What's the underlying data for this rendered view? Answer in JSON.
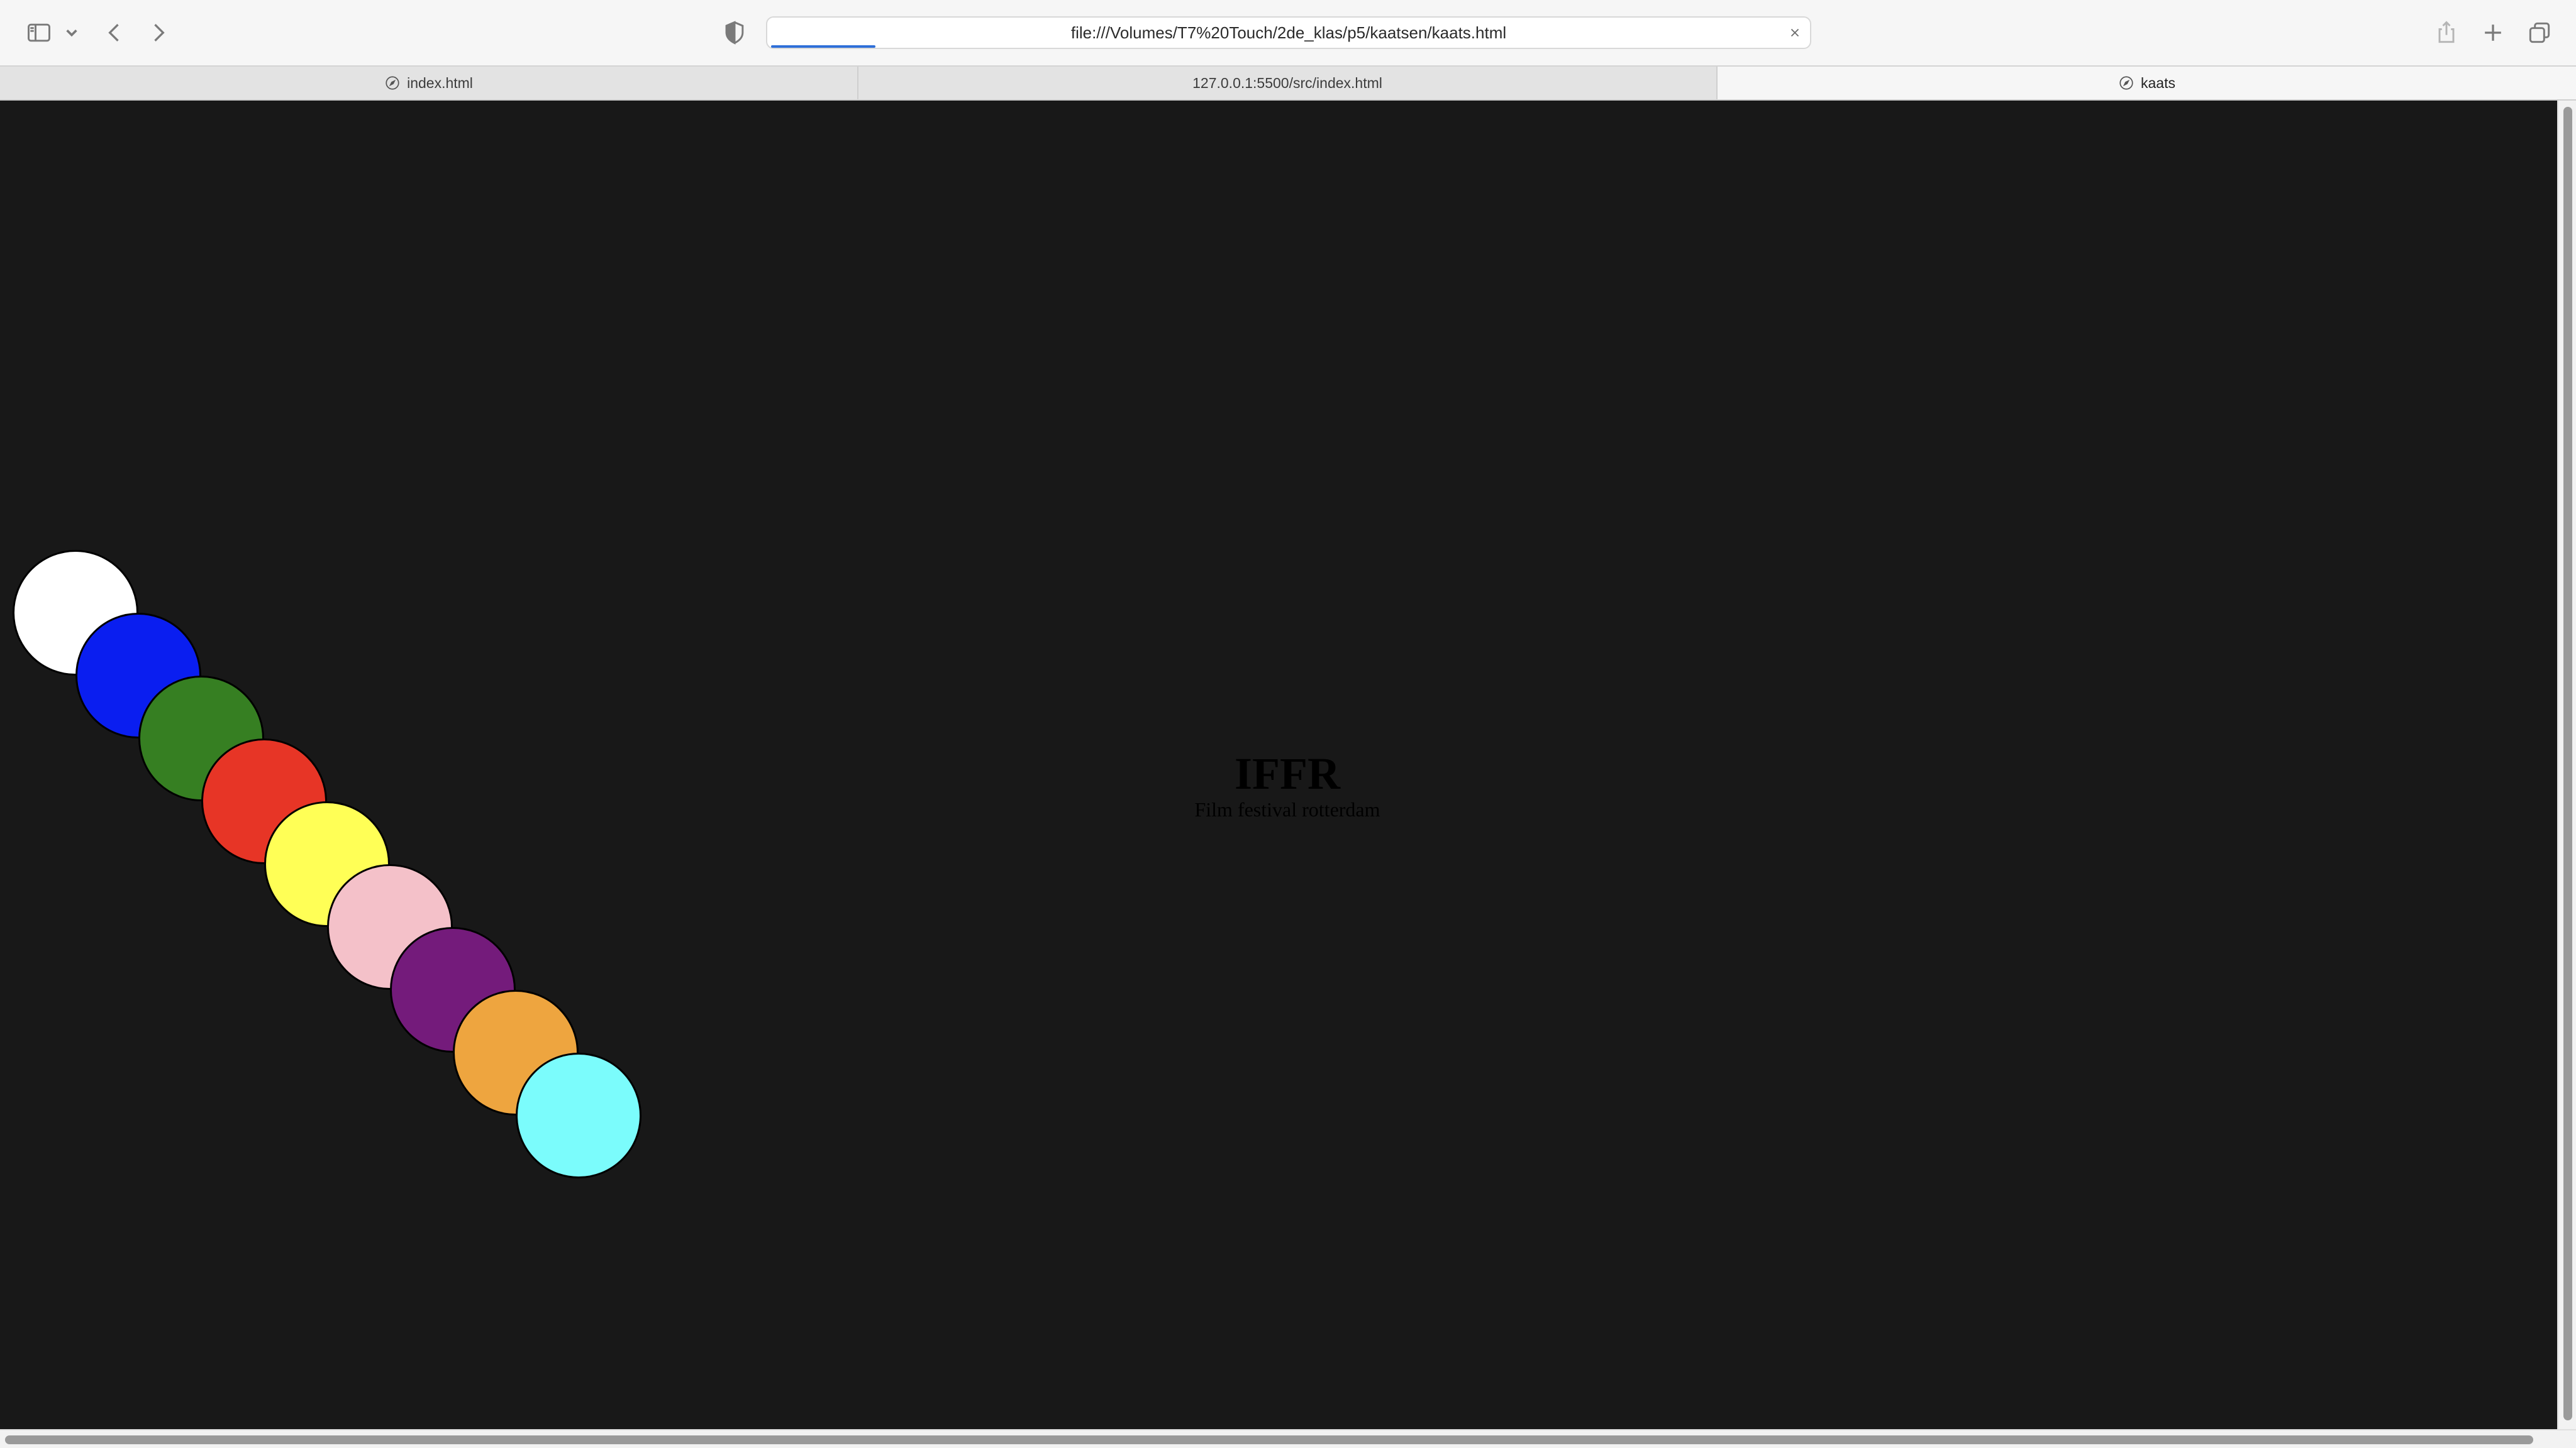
{
  "toolbar": {
    "url": "file:///Volumes/T7%20Touch/2de_klas/p5/kaatsen/kaats.html",
    "icons": [
      "sidebar-icon",
      "chevron-down-icon",
      "back-icon",
      "forward-icon",
      "shield-icon",
      "close-icon",
      "share-icon",
      "plus-icon",
      "tabs-overview-icon"
    ]
  },
  "tabs": [
    {
      "label": "index.html",
      "icon": "compass-icon"
    },
    {
      "label": "127.0.0.1:5500/src/index.html"
    },
    {
      "label": "kaats",
      "icon": "compass-icon",
      "active": true
    }
  ],
  "page": {
    "background": "#181818",
    "heading": "IFFR",
    "subheading": "Film festival rotterdam",
    "circle_colors": [
      "#ffffff",
      "#0a1ef0",
      "#367f22",
      "#e73526",
      "#ffff56",
      "#f4c1c9",
      "#741b7b",
      "#eea53f",
      "#7bfcfc"
    ]
  }
}
